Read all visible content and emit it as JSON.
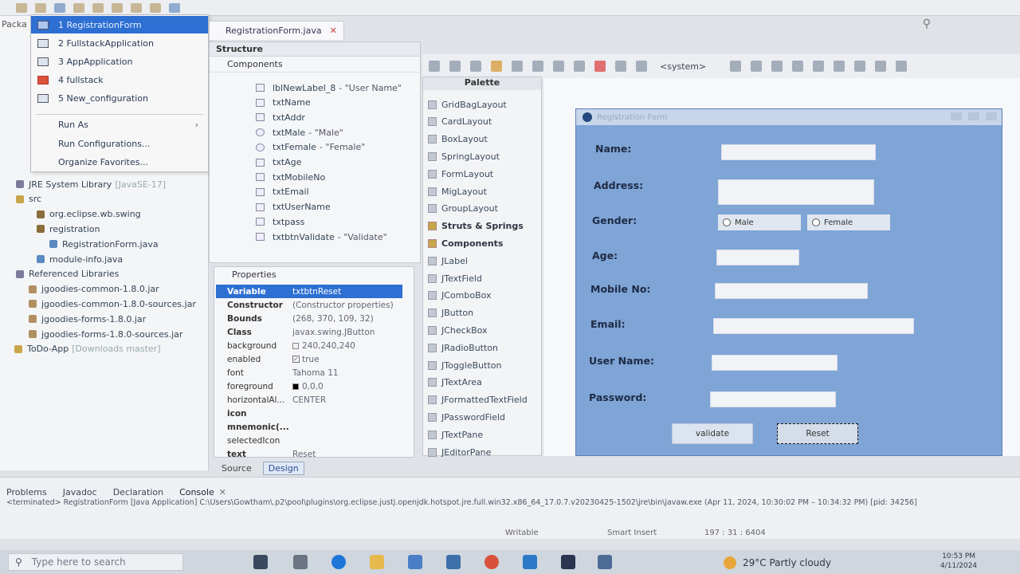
{
  "package_explorer": {
    "title": "Packa",
    "tree": [
      {
        "label": "JRE System Library",
        "muted": "[JavaSE-17]",
        "icon": "library-icon"
      },
      {
        "label": "src",
        "muted": "",
        "icon": "folder-icon"
      },
      {
        "label": "org.eclipse.wb.swing",
        "muted": "",
        "icon": "package-icon"
      },
      {
        "label": "registration",
        "muted": "",
        "icon": "package-icon"
      },
      {
        "label": "RegistrationForm.java",
        "muted": "",
        "icon": "java-file-icon"
      },
      {
        "label": "module-info.java",
        "muted": "",
        "icon": "java-file-icon"
      },
      {
        "label": "Referenced Libraries",
        "muted": "",
        "icon": "library-icon"
      },
      {
        "label": "jgoodies-common-1.8.0.jar",
        "muted": "",
        "icon": "jar-icon"
      },
      {
        "label": "jgoodies-common-1.8.0-sources.jar",
        "muted": "",
        "icon": "jar-icon"
      },
      {
        "label": "jgoodies-forms-1.8.0.jar",
        "muted": "",
        "icon": "jar-icon"
      },
      {
        "label": "jgoodies-forms-1.8.0-sources.jar",
        "muted": "",
        "icon": "jar-icon"
      },
      {
        "label": "ToDo-App",
        "muted": "[Downloads master]",
        "icon": "project-icon"
      }
    ]
  },
  "run_menu": {
    "items": [
      {
        "label": "1 RegistrationForm",
        "selected": true
      },
      {
        "label": "2 FullstackApplication",
        "selected": false
      },
      {
        "label": "3 AppApplication",
        "selected": false
      },
      {
        "label": "4 fullstack",
        "selected": false
      },
      {
        "label": "5 New_configuration",
        "selected": false
      }
    ],
    "run_as": "Run As",
    "run_configurations": "Run Configurations...",
    "organize_favorites": "Organize Favorites..."
  },
  "editor": {
    "tab_label": "RegistrationForm.java"
  },
  "structure": {
    "title": "Structure",
    "components_label": "Components",
    "items": [
      {
        "name": "lblNewLabel_8",
        "value": "- \"User Name\"",
        "icon": "label"
      },
      {
        "name": "txtName",
        "value": "",
        "icon": "field"
      },
      {
        "name": "txtAddr",
        "value": "",
        "icon": "field"
      },
      {
        "name": "txtMale",
        "value": "- \"Male\"",
        "icon": "radio"
      },
      {
        "name": "txtFemale",
        "value": "- \"Female\"",
        "icon": "radio"
      },
      {
        "name": "txtAge",
        "value": "",
        "icon": "field"
      },
      {
        "name": "txtMobileNo",
        "value": "",
        "icon": "field"
      },
      {
        "name": "txtEmail",
        "value": "",
        "icon": "field"
      },
      {
        "name": "txtUserName",
        "value": "",
        "icon": "field"
      },
      {
        "name": "txtpass",
        "value": "",
        "icon": "field"
      },
      {
        "name": "txtbtnValidate",
        "value": "- \"Validate\"",
        "icon": "button"
      }
    ]
  },
  "properties": {
    "title": "Properties",
    "rows": [
      {
        "key": "Variable",
        "value": "txtbtnReset",
        "bold": true,
        "selected": true,
        "kind": "text"
      },
      {
        "key": "Constructor",
        "value": "(Constructor properties)",
        "bold": true,
        "selected": false,
        "kind": "text"
      },
      {
        "key": "Bounds",
        "value": "(268, 370, 109, 32)",
        "bold": true,
        "selected": false,
        "kind": "text"
      },
      {
        "key": "Class",
        "value": "javax.swing.JButton",
        "bold": true,
        "selected": false,
        "kind": "text"
      },
      {
        "key": "background",
        "value": "240,240,240",
        "bold": false,
        "selected": false,
        "kind": "color",
        "color": "#f0f0f0"
      },
      {
        "key": "enabled",
        "value": "true",
        "bold": false,
        "selected": false,
        "kind": "check"
      },
      {
        "key": "font",
        "value": "Tahoma 11",
        "bold": false,
        "selected": false,
        "kind": "text"
      },
      {
        "key": "foreground",
        "value": "0,0,0",
        "bold": false,
        "selected": false,
        "kind": "color",
        "color": "#000000"
      },
      {
        "key": "horizontalAl...",
        "value": "CENTER",
        "bold": false,
        "selected": false,
        "kind": "text"
      },
      {
        "key": "icon",
        "value": "",
        "bold": true,
        "selected": false,
        "kind": "text"
      },
      {
        "key": "mnemonic(...",
        "value": "",
        "bold": true,
        "selected": false,
        "kind": "text"
      },
      {
        "key": "selectedIcon",
        "value": "",
        "bold": false,
        "selected": false,
        "kind": "text"
      },
      {
        "key": "text",
        "value": "Reset",
        "bold": true,
        "selected": false,
        "kind": "text"
      }
    ],
    "source_tab": "Source",
    "design_tab": "Design"
  },
  "designer_toolbar": {
    "system_label": "<system>"
  },
  "palette": {
    "title": "Palette",
    "items": [
      {
        "label": "GridBagLayout",
        "category": false
      },
      {
        "label": "CardLayout",
        "category": false
      },
      {
        "label": "BoxLayout",
        "category": false
      },
      {
        "label": "SpringLayout",
        "category": false
      },
      {
        "label": "FormLayout",
        "category": false
      },
      {
        "label": "MigLayout",
        "category": false
      },
      {
        "label": "GroupLayout",
        "category": false
      },
      {
        "label": "Struts & Springs",
        "category": true
      },
      {
        "label": "Components",
        "category": true
      },
      {
        "label": "JLabel",
        "category": false
      },
      {
        "label": "JTextField",
        "category": false
      },
      {
        "label": "JComboBox",
        "category": false
      },
      {
        "label": "JButton",
        "category": false
      },
      {
        "label": "JCheckBox",
        "category": false
      },
      {
        "label": "JRadioButton",
        "category": false
      },
      {
        "label": "JToggleButton",
        "category": false
      },
      {
        "label": "JTextArea",
        "category": false
      },
      {
        "label": "JFormattedTextField",
        "category": false
      },
      {
        "label": "JPasswordField",
        "category": false
      },
      {
        "label": "JTextPane",
        "category": false
      },
      {
        "label": "JEditorPane",
        "category": false
      }
    ]
  },
  "form": {
    "window_title": "Registration Form",
    "labels": {
      "name": "Name:",
      "address": "Address:",
      "gender": "Gender:",
      "age": "Age:",
      "mobile": "Mobile No:",
      "email": "Email:",
      "username": "User Name:",
      "password": "Password:"
    },
    "male": "Male",
    "female": "Female",
    "validate_btn": "validate",
    "reset_btn": "Reset"
  },
  "console": {
    "tabs": [
      "Problems",
      "Javadoc",
      "Declaration",
      "Console"
    ],
    "line": "<terminated> RegistrationForm [Java Application] C:\\Users\\Gowtham\\.p2\\pool\\plugins\\org.eclipse.justj.openjdk.hotspot.jre.full.win32.x86_64_17.0.7.v20230425-1502\\jre\\bin\\javaw.exe (Apr 11, 2024, 10:30:02 PM – 10:34:32 PM) [pid: 34256]",
    "writable": "Writable",
    "insert_mode": "Smart Insert",
    "position": "197 : 31 : 6404"
  },
  "taskbar": {
    "search_placeholder": "Type here to search",
    "weather": "29°C  Partly cloudy",
    "time": "10:53 PM",
    "date": "4/11/2024"
  }
}
